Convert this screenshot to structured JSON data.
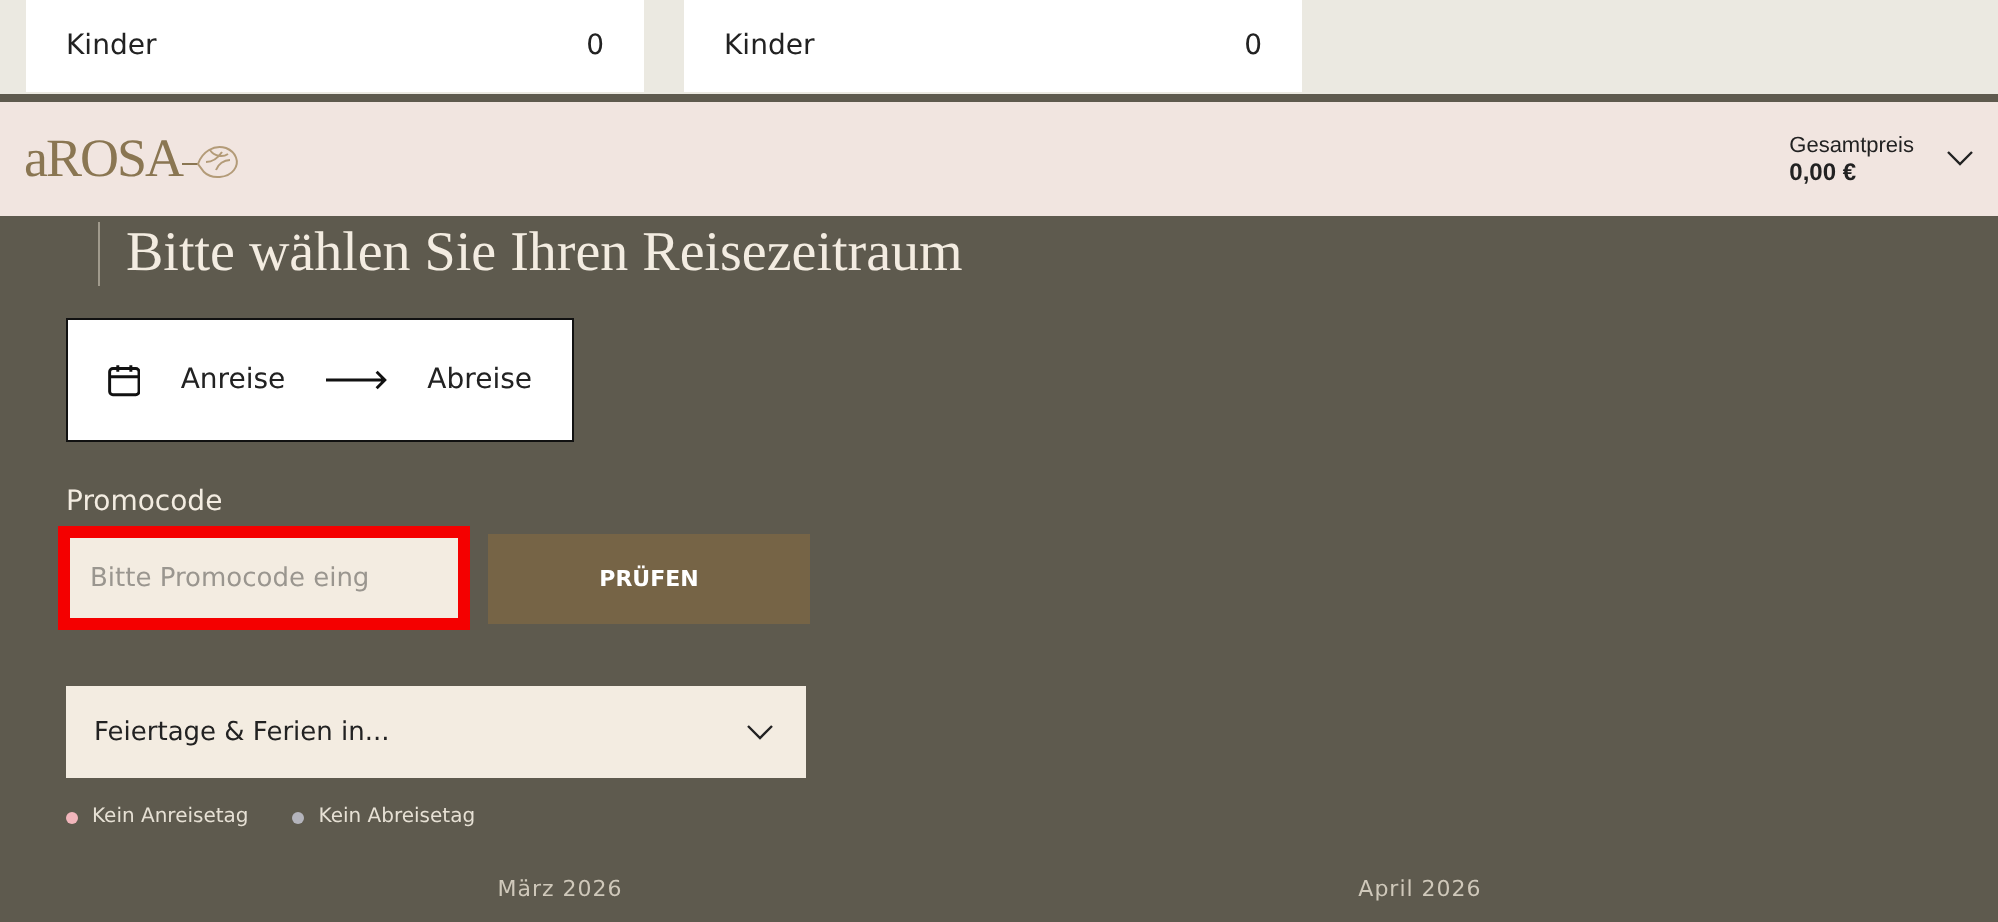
{
  "guest_cards": [
    {
      "label": "Kinder",
      "value": "0"
    },
    {
      "label": "Kinder",
      "value": "0"
    }
  ],
  "header": {
    "logo": "aROSA",
    "total_label": "Gesamtpreis",
    "total_value": "0,00 €",
    "expanded": false
  },
  "heading": "Bitte wählen Sie Ihren Reisezeitraum",
  "dates": {
    "arrival": "Anreise",
    "departure": "Abreise"
  },
  "promo": {
    "label": "Promocode",
    "placeholder": "Bitte Promocode eing",
    "highlighted": true,
    "button": "PRÜFEN"
  },
  "holidays": {
    "label": "Feiertage & Ferien in...",
    "expanded": false
  },
  "legend": [
    {
      "label": "Kein Anreisetag",
      "color": "#f2b6bc"
    },
    {
      "label": "Kein Abreisetag",
      "color": "#b4b4bc"
    }
  ],
  "months": [
    "März 2026",
    "April 2026"
  ]
}
